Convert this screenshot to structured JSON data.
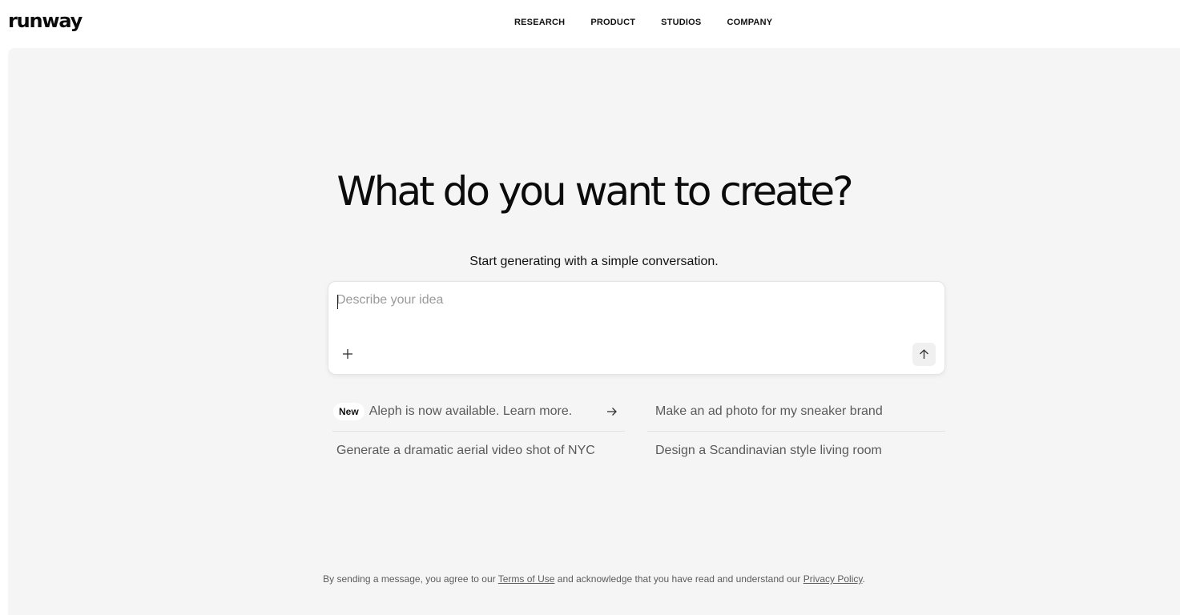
{
  "brand": {
    "logo_text": "runway"
  },
  "nav": {
    "items": [
      {
        "label": "RESEARCH"
      },
      {
        "label": "PRODUCT"
      },
      {
        "label": "STUDIOS"
      },
      {
        "label": "COMPANY"
      }
    ]
  },
  "hero": {
    "title": "What do you want to create?",
    "subtitle": "Start generating with a simple conversation."
  },
  "composer": {
    "placeholder": "Describe your idea",
    "value": "",
    "add_icon": "plus-icon",
    "send_icon": "arrow-up-icon"
  },
  "suggestions": [
    {
      "badge": "New",
      "text": "Aleph is now available. Learn more.",
      "icon": "arrow-right-icon"
    },
    {
      "text": "Make an ad photo for my sneaker brand"
    },
    {
      "text": "Generate a dramatic aerial video shot of NYC"
    },
    {
      "text": "Design a Scandinavian style living room"
    }
  ],
  "legal": {
    "prefix": "By sending a message, you agree to our",
    "terms_link": "Terms of Use",
    "middle": "and acknowledge that you have read and understand our",
    "privacy_link": "Privacy Policy",
    "suffix": "."
  },
  "colors": {
    "background": "#ffffff",
    "stage": "#f5f5f5",
    "text": "#111111",
    "muted": "#5a5a5a",
    "placeholder": "#9a9a9a"
  }
}
